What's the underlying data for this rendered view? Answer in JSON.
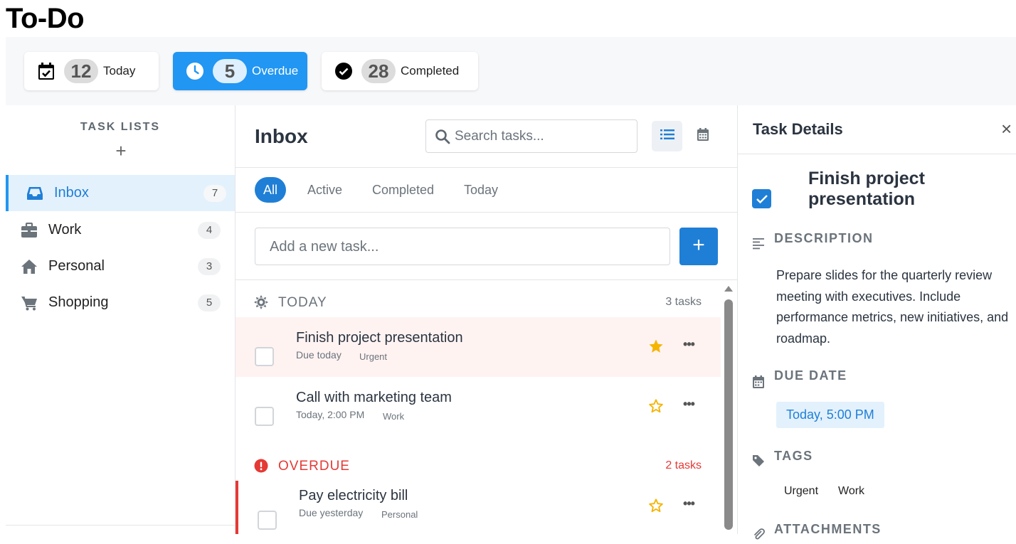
{
  "app": {
    "title": "To-Do"
  },
  "stats": [
    {
      "icon": "calendar-check-icon",
      "count": "12",
      "label": "Today",
      "active": false
    },
    {
      "icon": "clock-icon",
      "count": "5",
      "label": "Overdue",
      "active": true
    },
    {
      "icon": "check-circle-icon",
      "count": "28",
      "label": "Completed",
      "active": false
    }
  ],
  "sidebar": {
    "heading": "TASK LISTS",
    "add_label": "+",
    "items": [
      {
        "icon": "inbox-icon",
        "label": "Inbox",
        "count": "7",
        "active": true
      },
      {
        "icon": "briefcase-icon",
        "label": "Work",
        "count": "4",
        "active": false
      },
      {
        "icon": "home-icon",
        "label": "Personal",
        "count": "3",
        "active": false
      },
      {
        "icon": "cart-icon",
        "label": "Shopping",
        "count": "5",
        "active": false
      }
    ]
  },
  "main": {
    "title": "Inbox",
    "search_placeholder": "Search tasks...",
    "filters": [
      "All",
      "Active",
      "Completed",
      "Today"
    ],
    "active_filter": "All",
    "add_placeholder": "Add a new task...",
    "add_button": "+",
    "sections": [
      {
        "label": "TODAY",
        "count": "3 tasks",
        "tasks": [
          {
            "title": "Finish project presentation",
            "meta": "Due today",
            "tag": "Urgent",
            "starred": true
          },
          {
            "title": "Call with marketing team",
            "meta": "Today, 2:00 PM",
            "tag": "Work",
            "starred": false
          }
        ]
      },
      {
        "label": "OVERDUE",
        "count": "2 tasks",
        "tasks": [
          {
            "title": "Pay electricity bill",
            "meta": "Due yesterday",
            "tag": "Personal",
            "starred": false
          }
        ]
      }
    ],
    "more_label": "•••"
  },
  "details": {
    "header": "Task Details",
    "close_label": "×",
    "task_title": "Finish project presentation",
    "completed": true,
    "description_label": "DESCRIPTION",
    "description": "Prepare slides for the quarterly review meeting with executives. Include performance metrics, new initiatives, and roadmap.",
    "due_date_label": "DUE DATE",
    "due_date": "Today, 5:00 PM",
    "tags_label": "TAGS",
    "tags": [
      "Urgent",
      "Work"
    ],
    "attachments_label": "ATTACHMENTS"
  },
  "colors": {
    "accent": "#1f7fd6",
    "accent_light": "#2196f3",
    "overdue": "#e53935",
    "star": "#f5b400"
  }
}
